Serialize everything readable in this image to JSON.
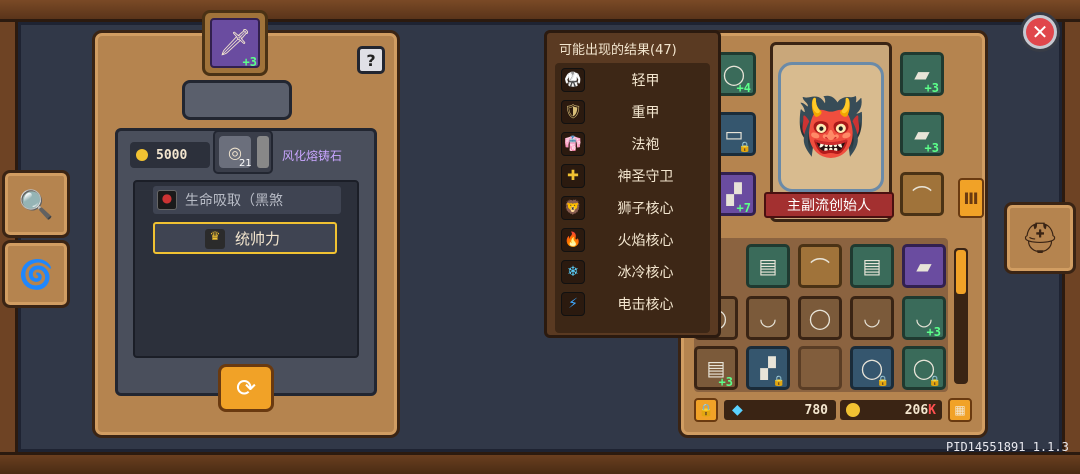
{
  "close_button": {
    "icon": "close-icon",
    "glyph": "✕"
  },
  "help_button": {
    "label": "?"
  },
  "weapon_slot": {
    "icon": "spear-icon",
    "plus": "+3"
  },
  "craft_panel": {
    "gold_amount": "5000",
    "stone_count": "21",
    "stone_name": "风化熔铸石",
    "effects": [
      {
        "icon": "blood-orb-icon",
        "label": "生命吸取（黑煞"
      },
      {
        "icon": "leadership-icon",
        "label": "统帅力"
      }
    ],
    "reroll_icon": "refresh-icon"
  },
  "popup": {
    "title": "可能出现的结果(47)",
    "items": [
      {
        "icon": "light-armor-icon",
        "label": "轻甲",
        "glyph": "🥋"
      },
      {
        "icon": "heavy-armor-icon",
        "label": "重甲",
        "glyph": "🛡"
      },
      {
        "icon": "robe-icon",
        "label": "法袍",
        "glyph": "👘"
      },
      {
        "icon": "holy-guard-icon",
        "label": "神圣守卫",
        "glyph": "✚"
      },
      {
        "icon": "lion-core-icon",
        "label": "狮子核心",
        "glyph": "🦁"
      },
      {
        "icon": "fire-core-icon",
        "label": "火焰核心",
        "glyph": "🔥"
      },
      {
        "icon": "ice-core-icon",
        "label": "冰冷核心",
        "glyph": "❄"
      },
      {
        "icon": "shock-core-icon",
        "label": "电击核心",
        "glyph": "⚡"
      }
    ]
  },
  "character": {
    "name": "主副流创始人"
  },
  "inventory": {
    "gems": "780",
    "gold": "206",
    "gold_suffix": "K"
  },
  "version": "PID14551891 1.1.3"
}
